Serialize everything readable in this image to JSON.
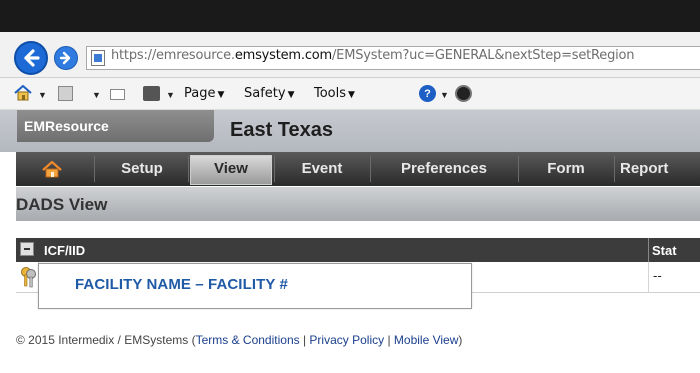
{
  "browser": {
    "url_prefix": "https://emresource.",
    "url_domain": "emsystem.com",
    "url_path": "/EMSystem?uc=GENERAL&nextStep=setRegion",
    "command_bar": {
      "page_label": "Page",
      "safety_label": "Safety",
      "tools_label": "Tools",
      "help_glyph": "?"
    }
  },
  "app": {
    "brand": "EMResource",
    "region_name": "East Texas"
  },
  "menu": {
    "items": [
      {
        "label": "Setup"
      },
      {
        "label": "View"
      },
      {
        "label": "Event"
      },
      {
        "label": "Preferences"
      },
      {
        "label": "Form"
      },
      {
        "label": "Report"
      }
    ],
    "active": "View"
  },
  "view": {
    "title": "DADS View"
  },
  "table": {
    "header_name": "ICF/IID",
    "header_status": "Stat",
    "rows": [
      {
        "name": "FACILITY NAME – FACILITY #",
        "status": "--"
      }
    ]
  },
  "footer": {
    "copyright": "© 2015 Intermedix / EMSystems (",
    "terms": "Terms & Conditions",
    "sep1": " | ",
    "privacy": "Privacy Policy",
    "sep2": " | ",
    "mobile": "Mobile View",
    "close": ")"
  },
  "colors": {
    "menu_bg": "#2a2a2a",
    "overlay_text": "#1f5aa6",
    "link": "#1a3f8c"
  }
}
